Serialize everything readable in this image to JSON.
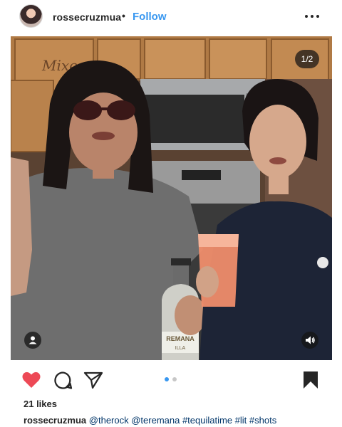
{
  "post": {
    "username": "rossecruzmua",
    "separator": "•",
    "follow_label": "Follow",
    "more_icon": "more-horizontal-icon",
    "media_counter": "1/2",
    "likes": "21 likes",
    "caption_user": "rossecruzmua",
    "caption_text": "@therock @teremana #tequilatime #lit #shots",
    "bottle_label": "REMANA",
    "bottle_sublabel": "ILLA",
    "sign_text": "Mixe",
    "carousel": {
      "total": 2,
      "active_index": 0
    }
  },
  "icons": {
    "like": "heart-icon",
    "comment": "comment-icon",
    "share": "send-icon",
    "save": "bookmark-icon",
    "tag": "user-tag-icon",
    "sound": "speaker-icon"
  },
  "colors": {
    "follow": "#3897f0",
    "like_active": "#ed4956",
    "carousel_active": "#3897f0",
    "carousel_inactive": "#c7c7c7",
    "hashtag": "#003569"
  }
}
